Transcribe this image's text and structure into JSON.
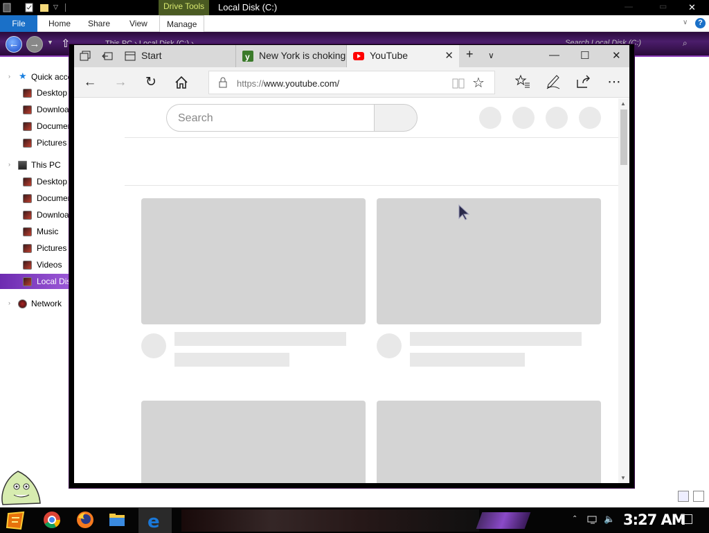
{
  "explorer": {
    "title": "Local Disk (C:)",
    "context_tab": "Drive Tools",
    "ribbon_tabs": [
      "File",
      "Home",
      "Share",
      "View",
      "Manage"
    ],
    "breadcrumb": "This PC  ›  Local Disk (C:)  ›",
    "search_placeholder": "Search Local Disk (C:)",
    "help_label": "?",
    "sidebar": [
      {
        "label": "Quick access",
        "icon": "quick-access-star-icon"
      },
      {
        "label": "Desktop",
        "icon": "desktop-folder-icon"
      },
      {
        "label": "Downloads",
        "icon": "downloads-folder-icon"
      },
      {
        "label": "Documents",
        "icon": "documents-folder-icon"
      },
      {
        "label": "Pictures",
        "icon": "pictures-folder-icon"
      },
      {
        "label": "This PC",
        "icon": "computer-icon"
      },
      {
        "label": "Desktop",
        "icon": "desktop-folder-icon"
      },
      {
        "label": "Documents",
        "icon": "documents-folder-icon"
      },
      {
        "label": "Downloads",
        "icon": "downloads-folder-icon"
      },
      {
        "label": "Music",
        "icon": "music-folder-icon"
      },
      {
        "label": "Pictures",
        "icon": "pictures-folder-icon"
      },
      {
        "label": "Videos",
        "icon": "videos-folder-icon"
      },
      {
        "label": "Local Disk (C:)",
        "icon": "drive-icon"
      },
      {
        "label": "Network",
        "icon": "network-icon"
      }
    ]
  },
  "browser": {
    "tabs": [
      {
        "label": "Start",
        "icon": "start-page-icon"
      },
      {
        "label": "New York is choking",
        "icon": "yahoo-favicon-icon"
      },
      {
        "label": "YouTube",
        "icon": "youtube-favicon-icon"
      }
    ],
    "active_tab": "YouTube",
    "url_scheme": "https://",
    "url_rest": "www.youtube.com/",
    "page": {
      "search_placeholder": "Search"
    }
  },
  "taskbar": {
    "apps": [
      "start-menu-icon",
      "chrome-icon",
      "firefox-icon",
      "file-explorer-icon",
      "edge-icon"
    ],
    "clock": "3:27 AM"
  },
  "colors": {
    "accent_purple": "#8a3ab8",
    "ribbon_file_blue": "#1a70c8",
    "youtube_red": "#ff0000",
    "placeholder_gray": "#d4d4d4"
  }
}
